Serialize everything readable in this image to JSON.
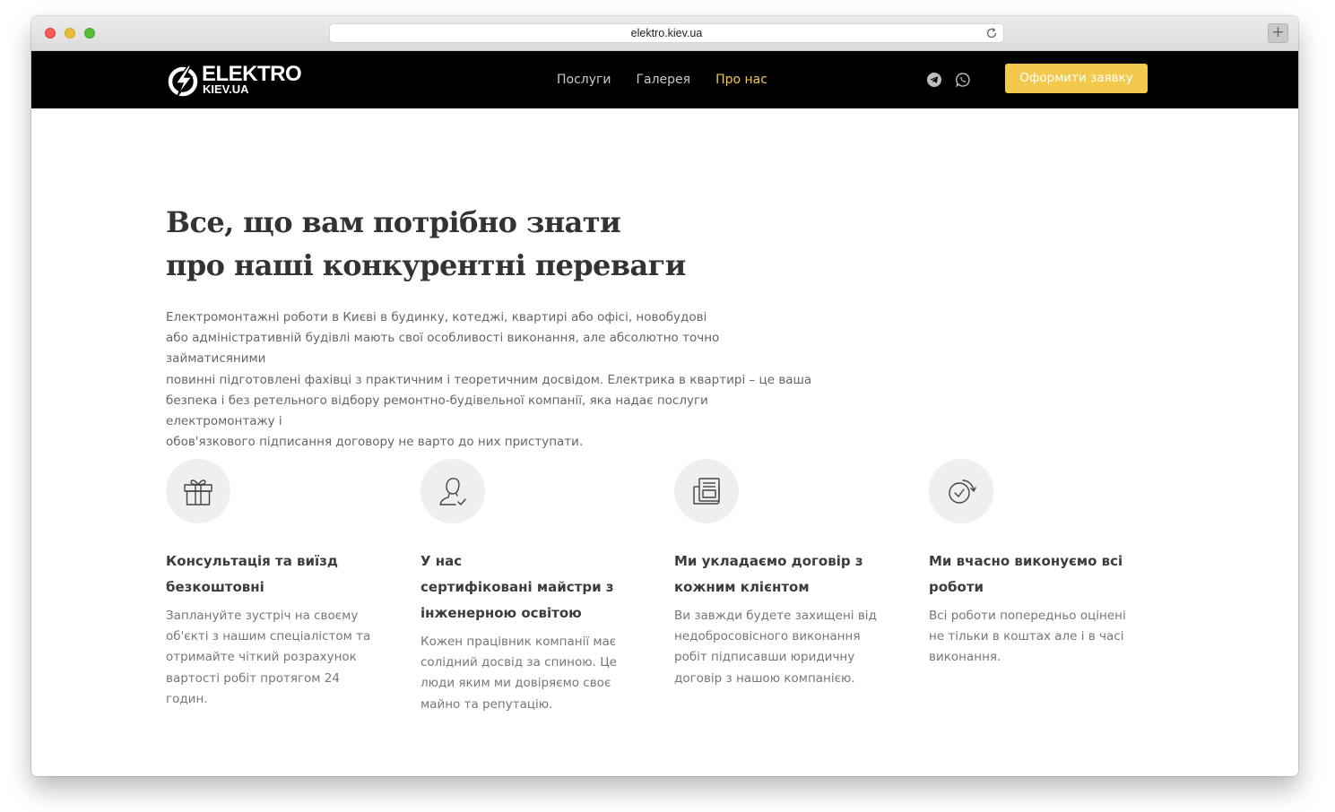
{
  "browser": {
    "url": "elektro.kiev.ua"
  },
  "nav": {
    "logo_main": "ELEKTRO",
    "logo_sub": "KIEV.UA",
    "links": [
      "Послуги",
      "Галерея",
      "Про нас"
    ],
    "cta": "Оформити заявку",
    "accent_color": "#f2c94c"
  },
  "hero": {
    "heading_line1": "Все, що вам потрібно знати",
    "heading_line2": "про наші конкурентні переваги",
    "intro": "Електромонтажні роботи в Києві в будинку,  котеджі, квартирі або офісі, новобудові\nабо адміністративній будівлі мають свої особливості виконання, але абсолютно точно займатисяними\nповинні підготовлені фахівці з практичним і теоретичним досвідом. Електрика в квартирі – це ваша\nбезпека і без ретельного відбору ремонтно-будівельної компанії, яка надає послуги електромонтажу і\nобов'язкового підписання договору не варто до них приступати."
  },
  "features": [
    {
      "icon": "gift-icon",
      "title": "Консультація та виїзд\nбезкоштовні",
      "desc": "Заплануйте зустріч на своєму\nоб'єкті з нашим спеціалістом та\nотримайте чіткий розрахунок\nвартості робіт протягом 24\nгодин."
    },
    {
      "icon": "certified-user-icon",
      "title": "У нас\nсертифіковані майстри з\nінженерною освітою",
      "desc": "Кожен працівник компанії має\nсолідний досвід за спиною. Це\nлюди яким ми довіряємо своє\nмайно та репутацію."
    },
    {
      "icon": "contract-icon",
      "title": "Ми укладаємо договір з\nкожним клієнтом",
      "desc": "Ви завжди будете захищені від\nнедобросовісного виконання\nробіт підписавши юридичну\nдоговір з нашою компанією."
    },
    {
      "icon": "clock-icon",
      "title": "Ми вчасно виконуємо всі\nроботи",
      "desc": "Всі роботи попередньо оцінені\nне тільки в коштах але і в часі\nвиконання."
    }
  ]
}
